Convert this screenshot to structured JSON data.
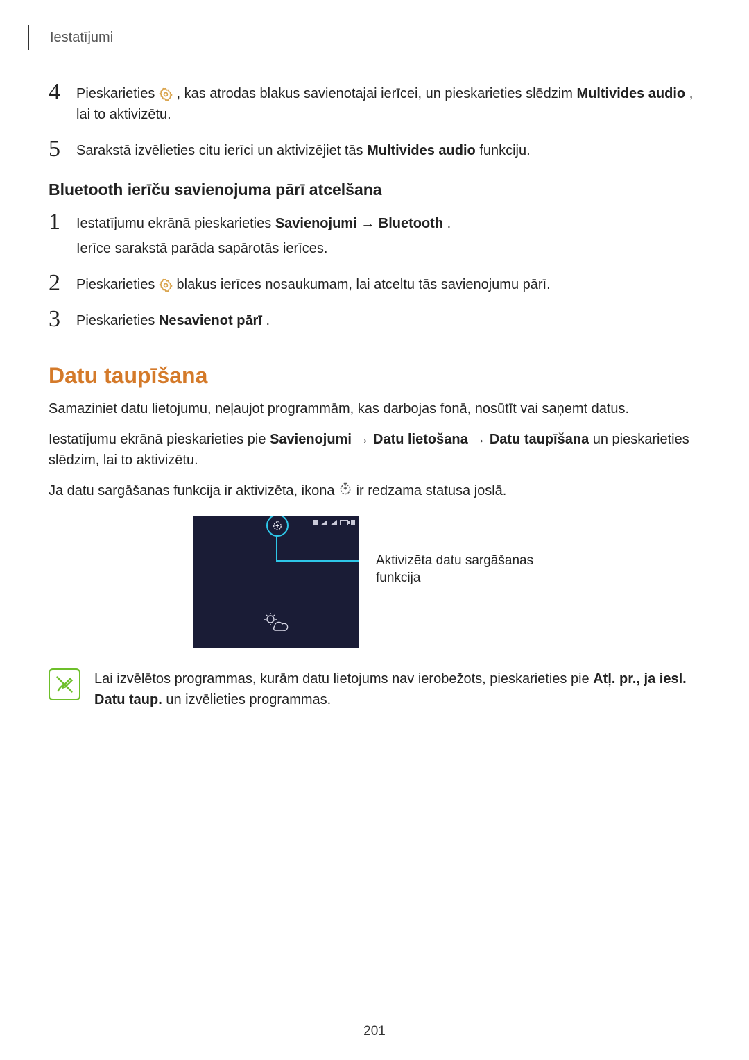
{
  "header": {
    "section": "Iestatījumi"
  },
  "stepsA": {
    "s4": {
      "num": "4",
      "t1": "Pieskarieties ",
      "t2": ", kas atrodas blakus savienotajai ierīcei, un pieskarieties slēdzim ",
      "bold1": "Multivides audio",
      "t3": ", lai to aktivizētu."
    },
    "s5": {
      "num": "5",
      "t1": "Sarakstā izvēlieties citu ierīci un aktivizējiet tās ",
      "bold1": "Multivides audio",
      "t2": " funkciju."
    }
  },
  "subheading": "Bluetooth ierīču savienojuma pārī atcelšana",
  "stepsB": {
    "s1": {
      "num": "1",
      "t1": "Iestatījumu ekrānā pieskarieties ",
      "bold1": "Savienojumi",
      "arrow": " → ",
      "bold2": "Bluetooth",
      "t2": ".",
      "sub": "Ierīce sarakstā parāda sapārotās ierīces."
    },
    "s2": {
      "num": "2",
      "t1": "Pieskarieties ",
      "t2": " blakus ierīces nosaukumam, lai atceltu tās savienojumu pārī."
    },
    "s3": {
      "num": "3",
      "t1": "Pieskarieties ",
      "bold1": "Nesavienot pārī",
      "t2": "."
    }
  },
  "datu": {
    "heading": "Datu taupīšana",
    "p1": "Samaziniet datu lietojumu, neļaujot programmām, kas darbojas fonā, nosūtīt vai saņemt datus.",
    "p2_a": "Iestatījumu ekrānā pieskarieties pie ",
    "p2_b1": "Savienojumi",
    "p2_arrow": " → ",
    "p2_b2": "Datu lietošana",
    "p2_b3": "Datu taupīšana",
    "p2_c": " un pieskarieties slēdzim, lai to aktivizētu.",
    "p3_a": "Ja datu sargāšanas funkcija ir aktivizēta, ikona ",
    "p3_b": " ir redzama statusa joslā."
  },
  "figure": {
    "callout": "Aktivizēta datu sargāšanas funkcija"
  },
  "note": {
    "t1": "Lai izvēlētos programmas, kurām datu lietojums nav ierobežots, pieskarieties pie ",
    "bold1": "Atļ. pr., ja iesl. Datu taup.",
    "t2": " un izvēlieties programmas."
  },
  "pageNumber": "201"
}
